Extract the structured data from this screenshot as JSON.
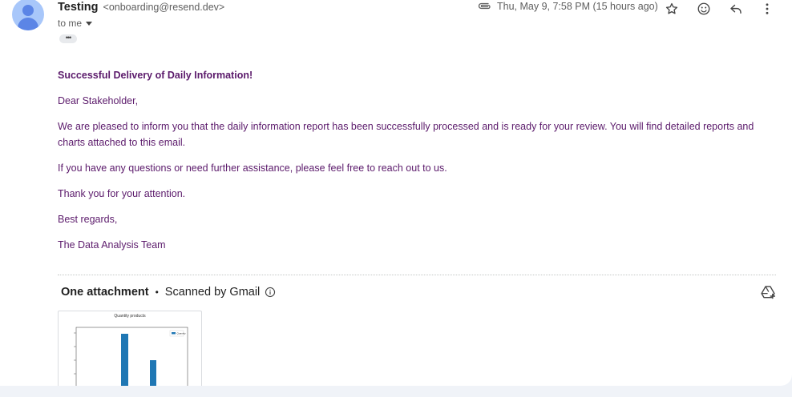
{
  "sender": {
    "name": "Testing",
    "email": "<onboarding@resend.dev>"
  },
  "recipient_label": "to me",
  "more_dots": "•••",
  "timestamp": "Thu, May 9, 7:58 PM (15 hours ago)",
  "toolbar_icons": [
    "paperclip-icon",
    "star-icon",
    "emoji-icon",
    "reply-icon",
    "more-vert-icon"
  ],
  "body": {
    "title": "Successful Delivery of Daily Information!",
    "paragraphs": [
      "Dear Stakeholder,",
      "We are pleased to inform you that the daily information report has been successfully processed and is ready for your review. You will find detailed reports and charts attached to this email.",
      "If you have any questions or need further assistance, please feel free to reach out to us.",
      "Thank you for your attention.",
      "Best regards,",
      "The Data Analysis Team"
    ]
  },
  "attachments": {
    "heading": "One attachment",
    "scan_status": "Scanned by Gmail",
    "thumbnail": {
      "chart_title": "Quantity products",
      "legend": "Quantity",
      "bar_color": "#1f77b4"
    }
  },
  "colors": {
    "body_text": "#5b1a6b",
    "avatar_bg": "#a8c7fa",
    "avatar_fg": "#5b85e6"
  }
}
